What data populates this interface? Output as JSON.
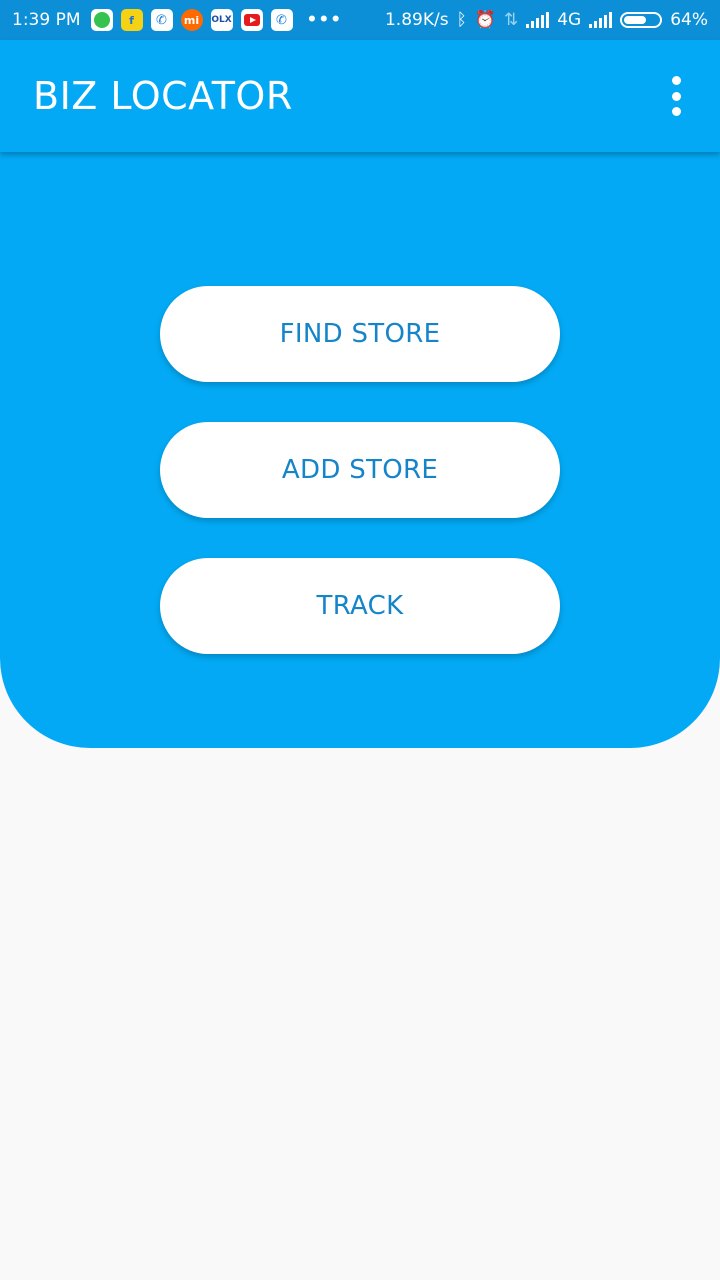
{
  "status_bar": {
    "time": "1:39 PM",
    "more": "•••",
    "net_speed": "1.89K/s",
    "network_type": "4G",
    "battery_percent": "64%",
    "battery_level": 0.64,
    "notification_icons": [
      "whatsapp-icon",
      "flipkart-icon",
      "phone-icon",
      "mi-icon",
      "olx-icon",
      "youtube-icon",
      "phone-icon"
    ],
    "olx_label": "OLX",
    "mi_label": "mi"
  },
  "app_bar": {
    "title": "BIZ LOCATOR"
  },
  "actions": {
    "find_store": "FIND STORE",
    "add_store": "ADD STORE",
    "track": "TRACK"
  },
  "colors": {
    "primary": "#03a9f4",
    "status_bar": "#0c8fd6",
    "button_text": "#1584c8",
    "background": "#f9f9f9"
  }
}
